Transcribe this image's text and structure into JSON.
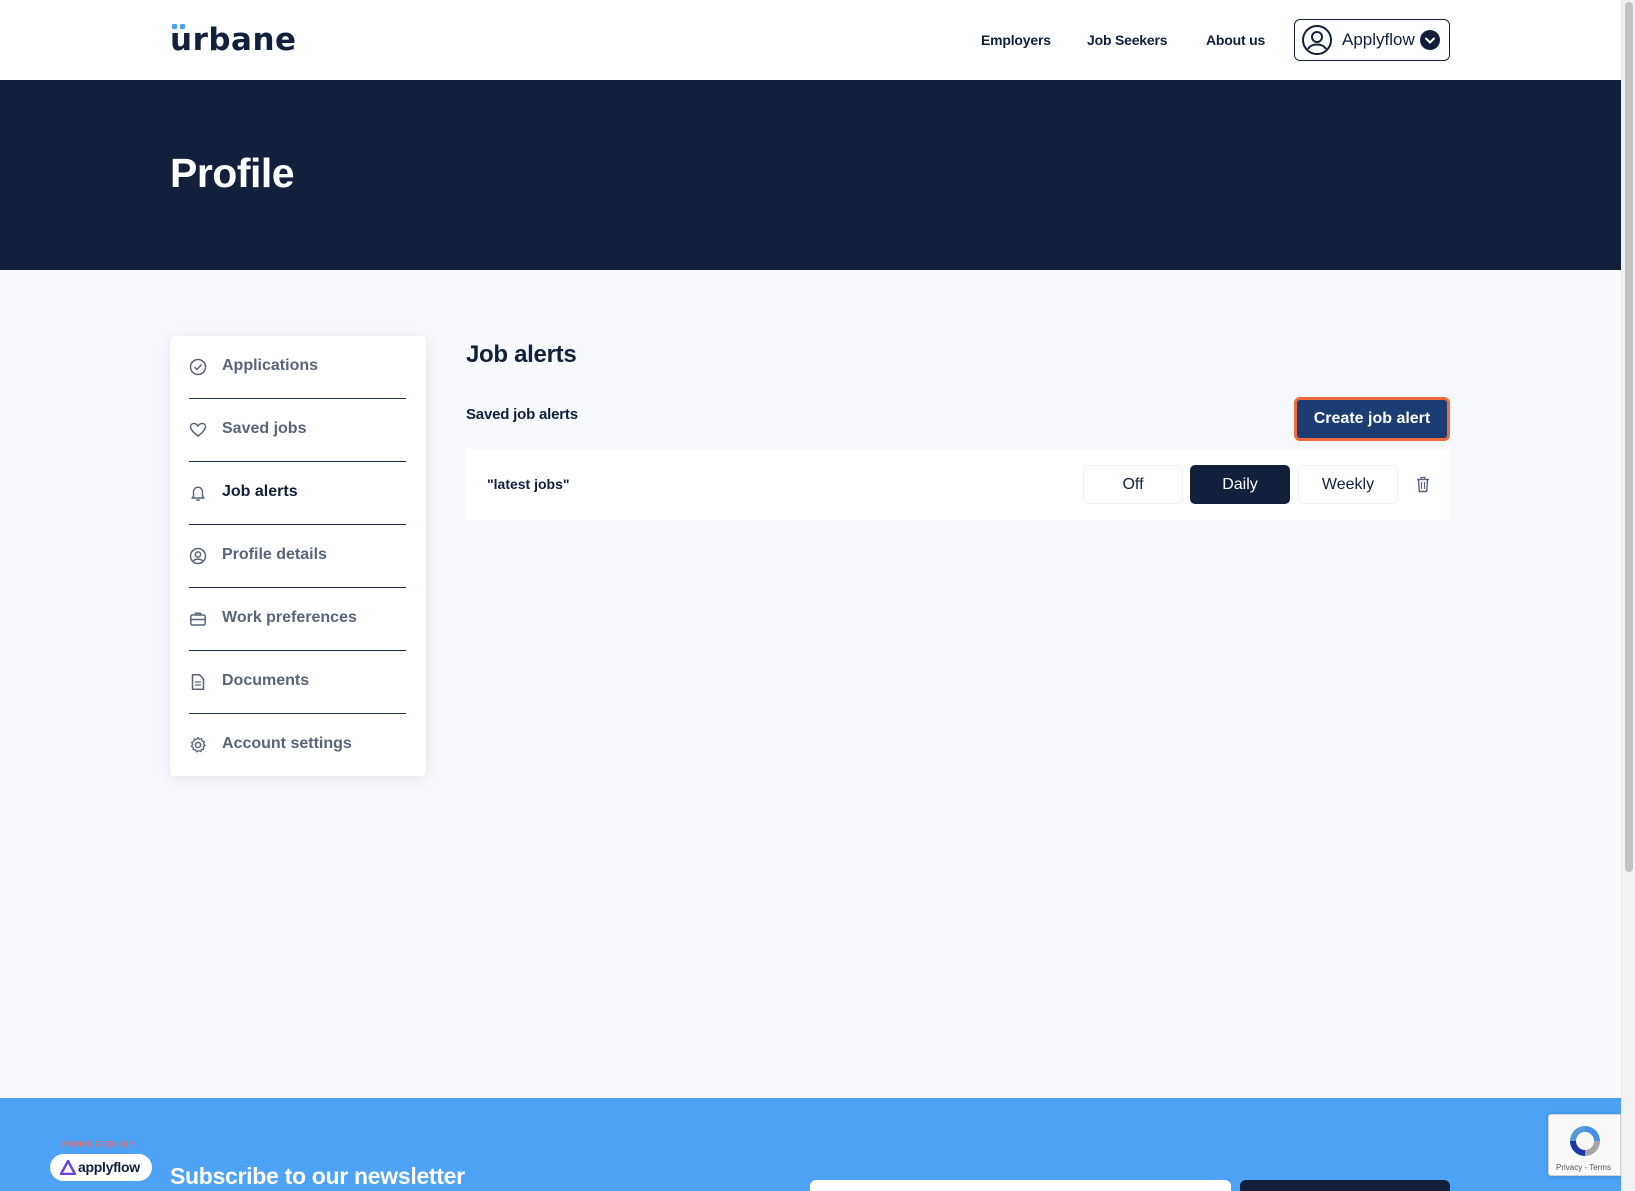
{
  "header": {
    "logo": "urbane",
    "nav": [
      "Employers",
      "Job Seekers",
      "About us"
    ],
    "account_label": "Applyflow"
  },
  "hero": {
    "title": "Profile"
  },
  "sidebar": {
    "items": [
      {
        "label": "Applications",
        "icon": "check-circle-icon",
        "active": false
      },
      {
        "label": "Saved jobs",
        "icon": "heart-icon",
        "active": false
      },
      {
        "label": "Job alerts",
        "icon": "bell-icon",
        "active": true
      },
      {
        "label": "Profile details",
        "icon": "user-circle-icon",
        "active": false
      },
      {
        "label": "Work preferences",
        "icon": "briefcase-icon",
        "active": false
      },
      {
        "label": "Documents",
        "icon": "document-icon",
        "active": false
      },
      {
        "label": "Account settings",
        "icon": "gear-icon",
        "active": false
      }
    ]
  },
  "main": {
    "title": "Job alerts",
    "saved_title": "Saved job alerts",
    "create_button": "Create job alert",
    "alerts": [
      {
        "name": "\"latest jobs\"",
        "frequency_options": [
          "Off",
          "Daily",
          "Weekly"
        ],
        "selected": "Daily"
      }
    ]
  },
  "footer": {
    "powered_by": "POWERED BY",
    "powered_brand": "applyflow",
    "newsletter_title": "Subscribe to our newsletter"
  },
  "recaptcha": {
    "text": "Privacy - Terms"
  },
  "colors": {
    "navy": "#12203b",
    "button_blue": "#1c3d73",
    "focus_orange": "#ef6b3b",
    "footer_blue": "#4ea3f7",
    "logo_accent": "#4aa3f5"
  }
}
